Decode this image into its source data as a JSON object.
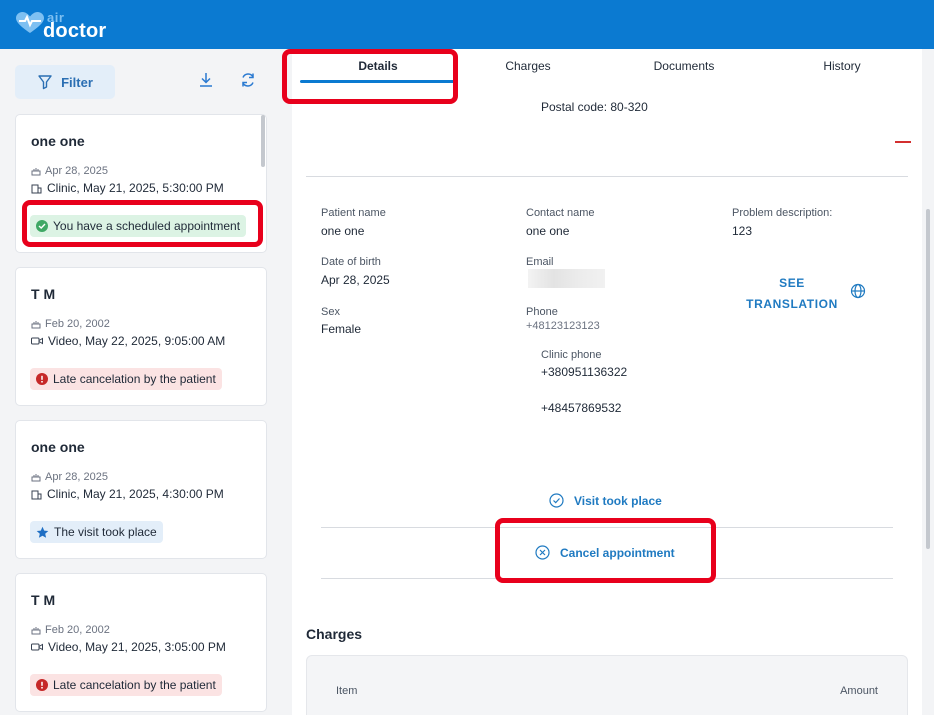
{
  "header": {
    "logo_top": "air",
    "logo_bottom": "doctor"
  },
  "left": {
    "filter_label": "Filter",
    "cards": [
      {
        "name": "one one",
        "dob": "Apr 28, 2025",
        "visit": "Clinic, May 21, 2025, 5:30:00 PM",
        "visit_type": "clinic",
        "status": "You have a scheduled appointment",
        "status_kind": "green"
      },
      {
        "name": "T M",
        "dob": "Feb 20, 2002",
        "visit": "Video, May 22, 2025, 9:05:00 AM",
        "visit_type": "video",
        "status": "Late cancelation by the patient",
        "status_kind": "red"
      },
      {
        "name": "one one",
        "dob": "Apr 28, 2025",
        "visit": "Clinic, May 21, 2025, 4:30:00 PM",
        "visit_type": "clinic",
        "status": "The visit took place",
        "status_kind": "blue"
      },
      {
        "name": "T M",
        "dob": "Feb 20, 2002",
        "visit": "Video, May 21, 2025, 3:05:00 PM",
        "visit_type": "video",
        "status": "Late cancelation by the patient",
        "status_kind": "red"
      }
    ]
  },
  "tabs": [
    "Details",
    "Charges",
    "Documents",
    "History"
  ],
  "details": {
    "postal": "Postal code: 80-320",
    "patient_name_label": "Patient name",
    "patient_name": "one one",
    "dob_label": "Date of birth",
    "dob": "Apr 28, 2025",
    "sex_label": "Sex",
    "sex": "Female",
    "contact_name_label": "Contact name",
    "contact_name": "one one",
    "email_label": "Email",
    "phone_label": "Phone",
    "phone": "+48123123123",
    "clinic_phone_label": "Clinic phone",
    "clinic_phone_1": "+380951136322",
    "clinic_phone_2": "+48457869532",
    "problem_label": "Problem description:",
    "problem": "123",
    "see_translation": "SEE TRANSLATION",
    "visit_took_place": "Visit took place",
    "cancel_appointment": "Cancel appointment"
  },
  "charges": {
    "title": "Charges",
    "col_item": "Item",
    "col_amount": "Amount"
  },
  "colors": {
    "brand": "#0b7ad1",
    "accent_text": "#1f7ac1",
    "highlight": "#e8001c"
  }
}
